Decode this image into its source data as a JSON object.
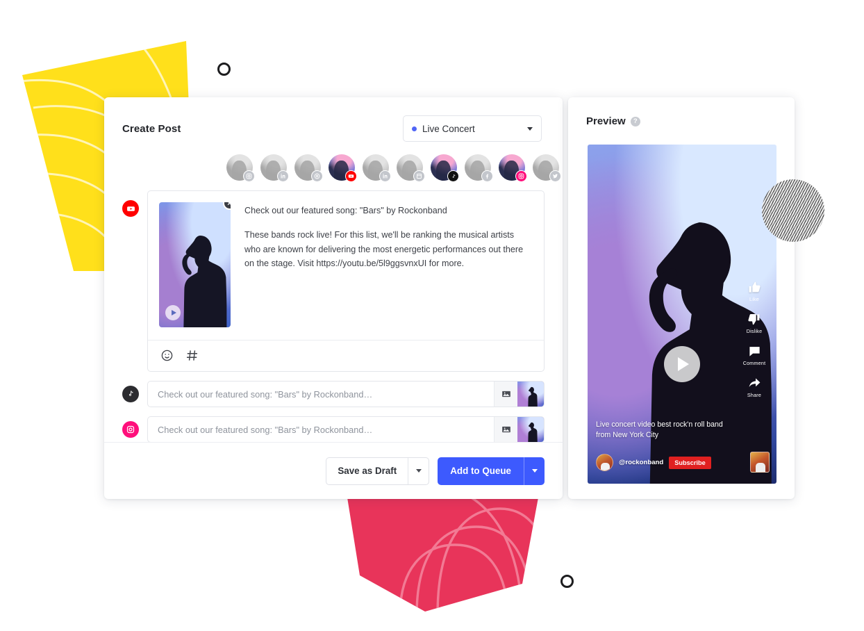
{
  "create_post": {
    "title": "Create Post",
    "scope_select": {
      "label": "Live Concert",
      "dot_color": "#5065f6"
    },
    "accounts": [
      {
        "platform": "instagram",
        "active": false
      },
      {
        "platform": "linkedin",
        "active": false
      },
      {
        "platform": "pinterest",
        "active": false
      },
      {
        "platform": "youtube",
        "active": true
      },
      {
        "platform": "linkedin",
        "active": false
      },
      {
        "platform": "business",
        "active": false
      },
      {
        "platform": "tiktok",
        "active": true
      },
      {
        "platform": "facebook",
        "active": false
      },
      {
        "platform": "instagram",
        "active": true
      },
      {
        "platform": "twitter",
        "active": false
      }
    ],
    "composer": {
      "platform": "youtube",
      "title_line": "Check out our featured song: \"Bars\" by Rockonband",
      "body_line": "These bands rock live! For this list, we'll be ranking the musical artists who are known for delivering the most energetic performances out there on the stage. Visit https://youtu.be/5l9ggsvnxUI for more.",
      "toolbar": {
        "emoji": "emoji-icon",
        "hashtag": "#"
      },
      "remove_label": "×"
    },
    "rows": [
      {
        "platform": "tiktok",
        "placeholder": "Check out our featured song: \"Bars\" by Rockonband…"
      },
      {
        "platform": "instagram",
        "placeholder": "Check out our featured song: \"Bars\" by Rockonband…"
      }
    ],
    "footer": {
      "draft_label": "Save as Draft",
      "primary_label": "Add to Queue",
      "primary_color": "#3d5afe"
    }
  },
  "preview": {
    "title": "Preview",
    "help_glyph": "?",
    "actions": [
      {
        "name": "like",
        "label": "Like"
      },
      {
        "name": "dislike",
        "label": "Dislike"
      },
      {
        "name": "comment",
        "label": "Comment"
      },
      {
        "name": "share",
        "label": "Share"
      }
    ],
    "caption": "Live concert video best rock'n roll band from New York City",
    "handle": "@rockonband",
    "subscribe_label": "Subscribe"
  }
}
